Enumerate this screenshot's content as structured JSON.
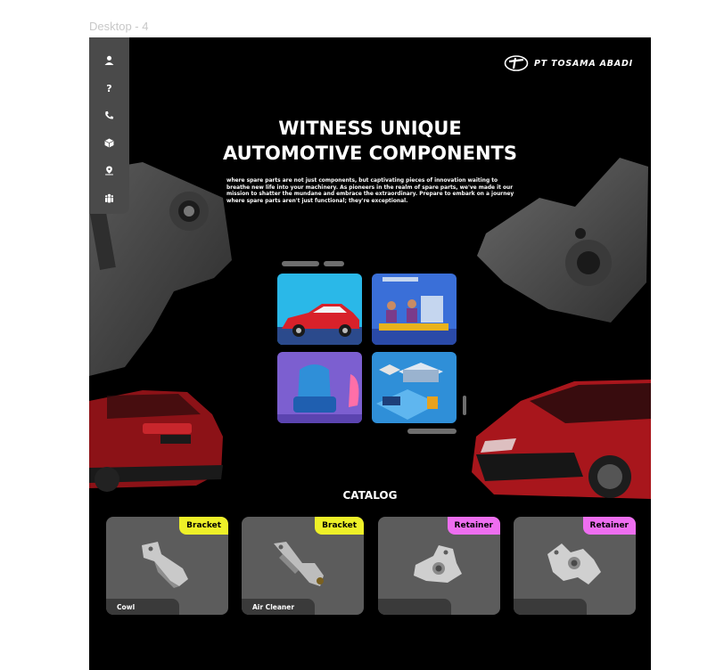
{
  "frame_label": "Desktop - 4",
  "sidebar": {
    "items": [
      {
        "icon": "user-icon"
      },
      {
        "icon": "question-icon"
      },
      {
        "icon": "phone-icon"
      },
      {
        "icon": "box-icon"
      },
      {
        "icon": "location-icon"
      },
      {
        "icon": "team-icon"
      }
    ]
  },
  "brand": {
    "name": "PT TOSAMA ABADI"
  },
  "hero": {
    "title_line1": "WITNESS UNIQUE",
    "title_line2": "AUTOMOTIVE COMPONENTS",
    "description": "where spare parts are not just components, but captivating pieces of innovation waiting to breathe new life into your machinery. As pioneers in the realm of spare parts, we've made it our mission to shatter the mundane and embrace the extraordinary. Prepare to embark on a journey where spare parts aren't just functional; they're exceptional."
  },
  "catalog": {
    "title": "CATALOG",
    "items": [
      {
        "badge": "Bracket",
        "badge_color": "#eef028",
        "name": "Cowl"
      },
      {
        "badge": "Bracket",
        "badge_color": "#eef028",
        "name": "Air Cleaner"
      },
      {
        "badge": "Retainer",
        "badge_color": "#ee6ef0",
        "name": ""
      },
      {
        "badge": "Retainer",
        "badge_color": "#ee6ef0",
        "name": ""
      }
    ]
  },
  "colors": {
    "background": "#000000",
    "sidebar": "#4a4a4a",
    "card": "#5c5c5c",
    "car_red": "#a8161c"
  }
}
